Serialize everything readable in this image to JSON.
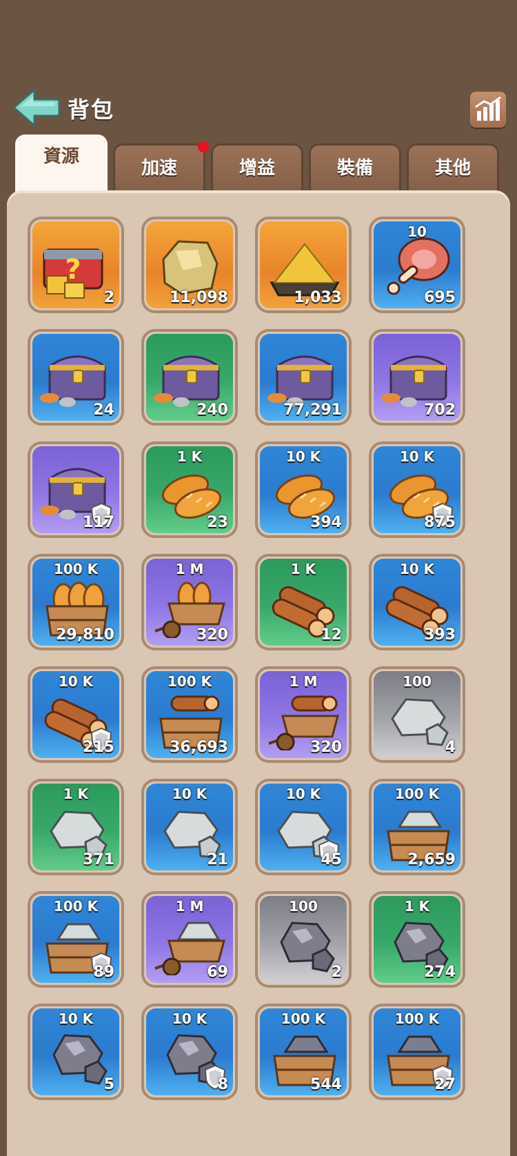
{
  "header": {
    "title": "背包"
  },
  "tabs": [
    {
      "label": "資源",
      "active": true
    },
    {
      "label": "加速",
      "badge": true
    },
    {
      "label": "增益"
    },
    {
      "label": "裝備"
    },
    {
      "label": "其他"
    }
  ],
  "items": [
    {
      "icon": "mystery-chest-icon",
      "tag": "",
      "count": "2",
      "quality": "orange"
    },
    {
      "icon": "gold-nugget-icon",
      "tag": "",
      "count": "11,098",
      "quality": "orange"
    },
    {
      "icon": "gold-dust-icon",
      "tag": "",
      "count": "1,033",
      "quality": "orange"
    },
    {
      "icon": "ham-icon",
      "tag": "10",
      "count": "695",
      "quality": "blue"
    },
    {
      "icon": "resource-chest-icon",
      "tag": "",
      "count": "24",
      "quality": "blue"
    },
    {
      "icon": "resource-chest-icon",
      "tag": "",
      "count": "240",
      "quality": "green"
    },
    {
      "icon": "resource-chest-icon",
      "tag": "",
      "count": "77,291",
      "quality": "blue"
    },
    {
      "icon": "resource-chest-icon",
      "tag": "",
      "count": "702",
      "quality": "purple"
    },
    {
      "icon": "resource-chest-icon",
      "tag": "",
      "count": "117",
      "quality": "purple",
      "shield": true
    },
    {
      "icon": "bread-icon",
      "tag": "1 K",
      "count": "23",
      "quality": "green"
    },
    {
      "icon": "bread-icon",
      "tag": "10 K",
      "count": "394",
      "quality": "blue"
    },
    {
      "icon": "bread-icon",
      "tag": "10 K",
      "count": "875",
      "quality": "blue",
      "shield": true
    },
    {
      "icon": "bread-crate-icon",
      "tag": "100 K",
      "count": "29,810",
      "quality": "blue"
    },
    {
      "icon": "bread-cart-icon",
      "tag": "1 M",
      "count": "320",
      "quality": "purple"
    },
    {
      "icon": "wood-icon",
      "tag": "1 K",
      "count": "12",
      "quality": "green"
    },
    {
      "icon": "wood-icon",
      "tag": "10 K",
      "count": "393",
      "quality": "blue"
    },
    {
      "icon": "wood-icon",
      "tag": "10 K",
      "count": "215",
      "quality": "blue",
      "shield": true
    },
    {
      "icon": "wood-crate-icon",
      "tag": "100 K",
      "count": "36,693",
      "quality": "blue"
    },
    {
      "icon": "wood-cart-icon",
      "tag": "1 M",
      "count": "320",
      "quality": "purple"
    },
    {
      "icon": "stone-icon",
      "tag": "100",
      "count": "4",
      "quality": "gray"
    },
    {
      "icon": "stone-icon",
      "tag": "1 K",
      "count": "371",
      "quality": "green"
    },
    {
      "icon": "stone-icon",
      "tag": "10 K",
      "count": "21",
      "quality": "blue"
    },
    {
      "icon": "stone-icon",
      "tag": "10 K",
      "count": "45",
      "quality": "blue",
      "shield": true
    },
    {
      "icon": "stone-crate-icon",
      "tag": "100 K",
      "count": "2,659",
      "quality": "blue"
    },
    {
      "icon": "stone-crate-icon",
      "tag": "100 K",
      "count": "89",
      "quality": "blue",
      "shield": true
    },
    {
      "icon": "stone-cart-icon",
      "tag": "1 M",
      "count": "69",
      "quality": "purple"
    },
    {
      "icon": "iron-ore-icon",
      "tag": "100",
      "count": "2",
      "quality": "gray"
    },
    {
      "icon": "iron-ore-icon",
      "tag": "1 K",
      "count": "274",
      "quality": "green"
    },
    {
      "icon": "iron-ore-icon",
      "tag": "10 K",
      "count": "5",
      "quality": "blue"
    },
    {
      "icon": "iron-ore-icon",
      "tag": "10 K",
      "count": "8",
      "quality": "blue",
      "shield": true
    },
    {
      "icon": "iron-crate-icon",
      "tag": "100 K",
      "count": "544",
      "quality": "blue"
    },
    {
      "icon": "iron-crate-icon",
      "tag": "100 K",
      "count": "27",
      "quality": "blue",
      "shield": true
    }
  ]
}
